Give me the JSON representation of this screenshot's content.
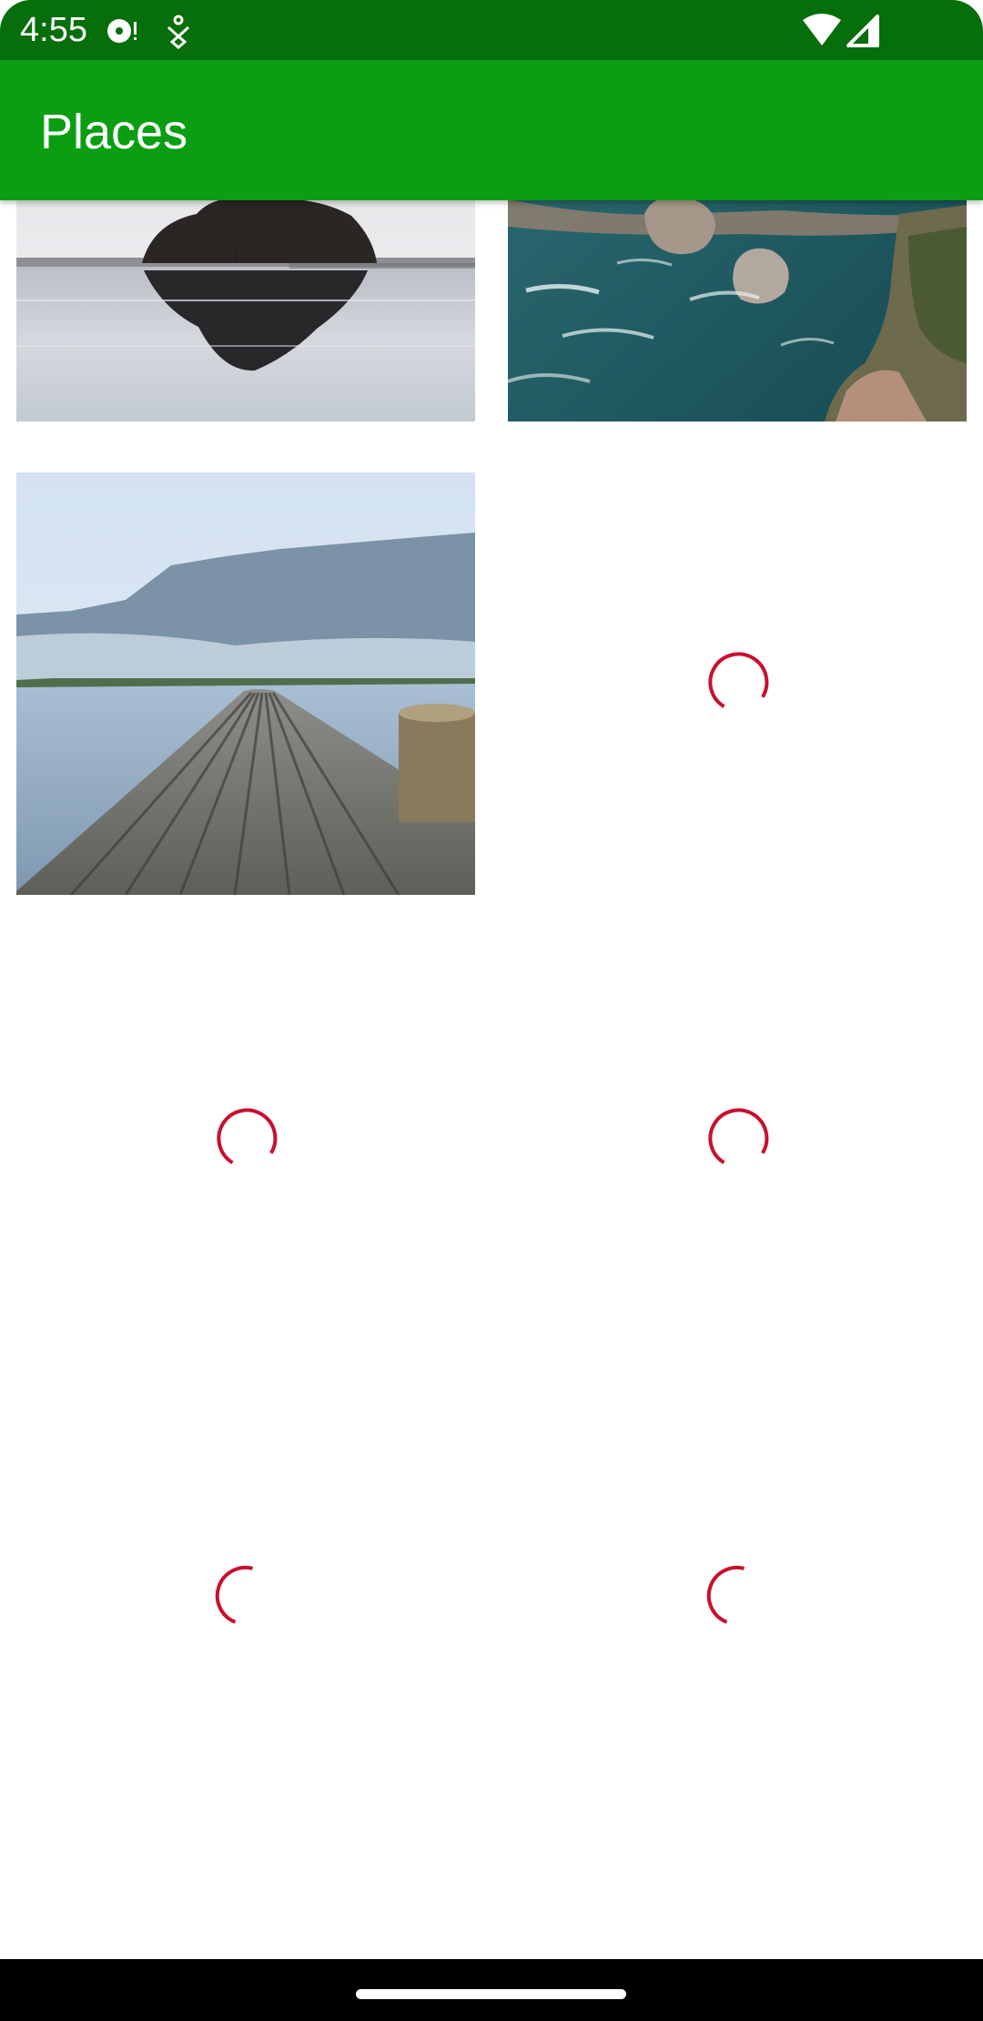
{
  "status_bar": {
    "time": "4:55",
    "icons": [
      "media-session-icon",
      "accessibility-icon",
      "wifi-icon",
      "signal-icon"
    ],
    "background": "#066e0a"
  },
  "app_bar": {
    "title": "Places",
    "background": "#0b9e12"
  },
  "grid": {
    "columns": 2,
    "tiles": [
      {
        "state": "loaded",
        "image": "sea-rock-reflection-photo"
      },
      {
        "state": "loaded",
        "image": "coastal-cliffs-photo"
      },
      {
        "state": "loaded",
        "image": "wooden-pier-lake-photo"
      },
      {
        "state": "loading"
      },
      {
        "state": "loading"
      },
      {
        "state": "loading"
      },
      {
        "state": "loading"
      },
      {
        "state": "loading"
      }
    ]
  },
  "colors": {
    "spinner": "#c8102e",
    "nav_bar": "#000000"
  }
}
